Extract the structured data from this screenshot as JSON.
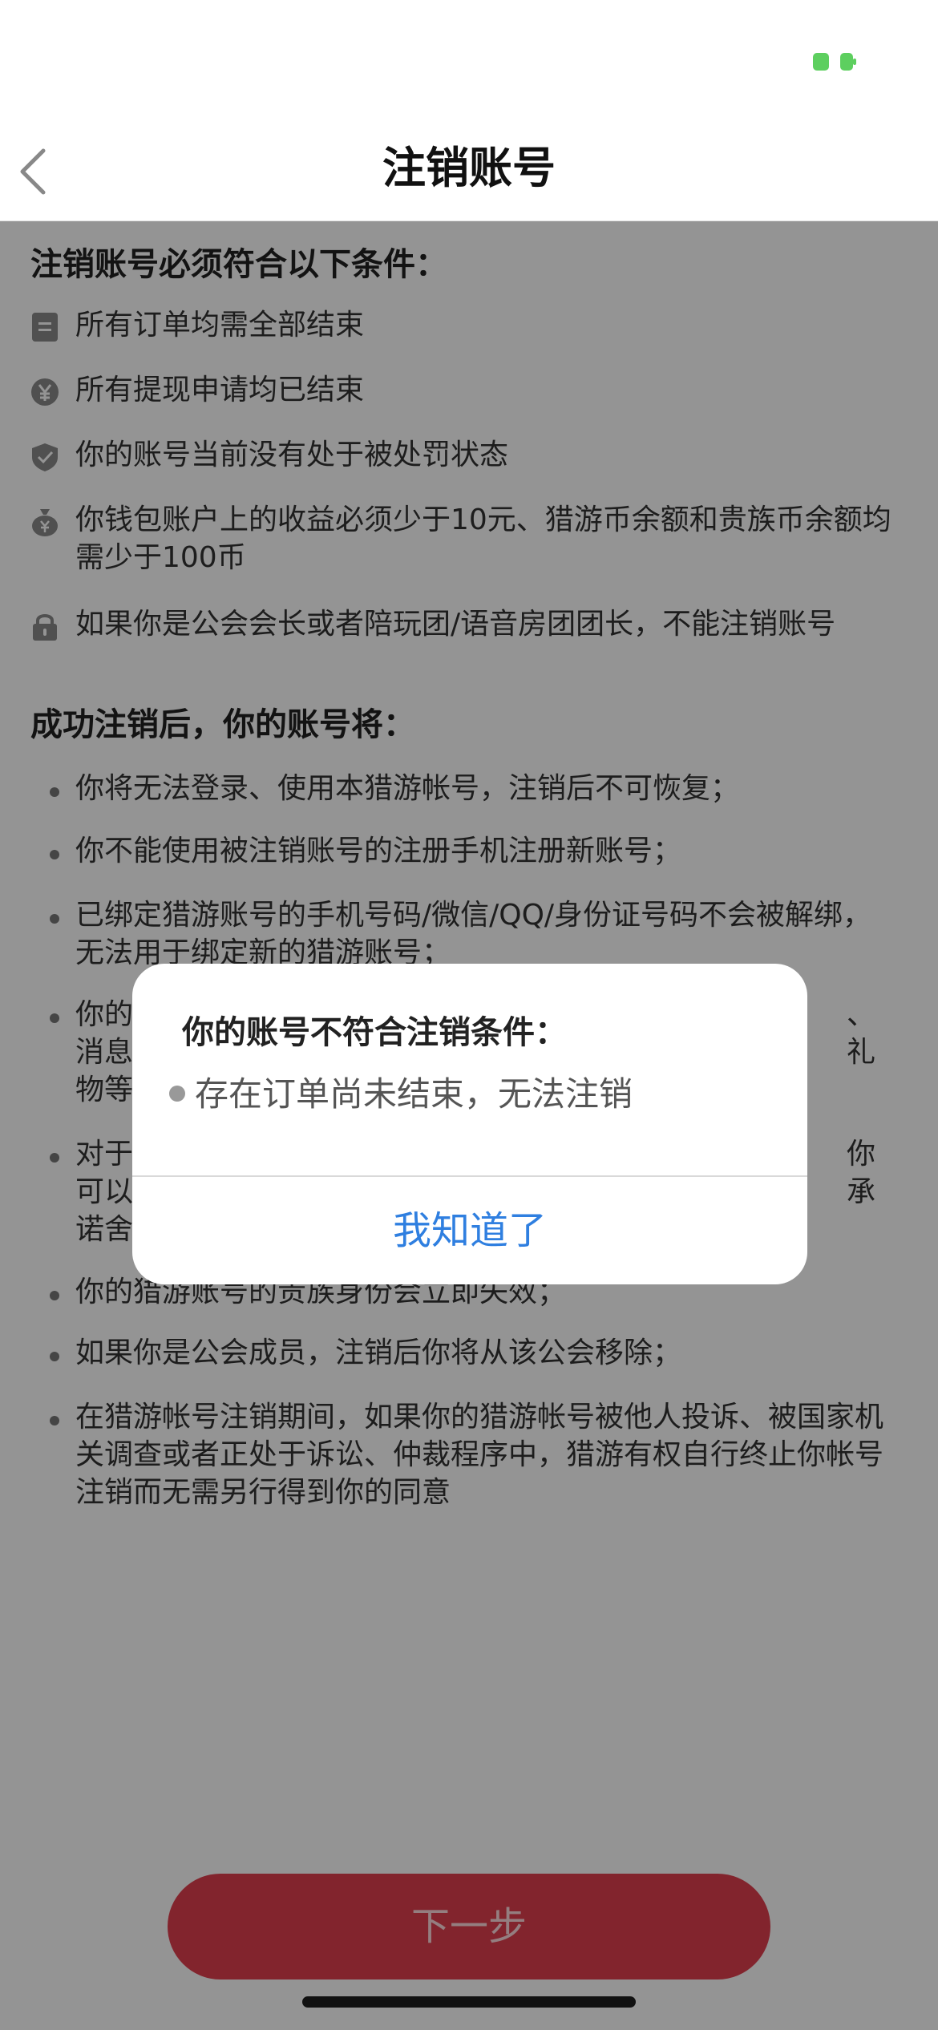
{
  "nav": {
    "title": "注销账号"
  },
  "conditions": {
    "heading": "注销账号必须符合以下条件：",
    "items": [
      {
        "icon": "order-icon",
        "text": "所有订单均需全部结束"
      },
      {
        "icon": "yen-icon",
        "text": "所有提现申请均已结束"
      },
      {
        "icon": "shield-icon",
        "text": "你的账号当前没有处于被处罚状态"
      },
      {
        "icon": "money-bag-icon",
        "text": "你钱包账户上的收益必须少于10元、猎游币余额和贵族币余额均需少于100币"
      },
      {
        "icon": "lock-icon",
        "text": "如果你是公会会长或者陪玩团/语音房团团长，不能注销账号"
      }
    ]
  },
  "after": {
    "heading": "成功注销后，你的账号将：",
    "items": [
      "你将无法登录、使用本猎游帐号，注销后不可恢复；",
      "你不能使用被注销账号的注册手机注册新账号；",
      "已绑定猎游账号的手机号码/微信/QQ/身份证号码不会被解绑，无法用于绑定新的猎游账号；",
      "你的",
      "消息",
      "物等",
      "对于",
      "可以",
      "诺舍",
      "你的猎游账号的贵族身份会立即失效；",
      "如果你是公会成员，注销后你将从该公会移除；",
      "在猎游帐号注销期间，如果你的猎游帐号被他人投诉、被国家机关调查或者正处于诉讼、仲裁程序中，猎游有权自行终止你帐号注销而无需另行得到你的同意"
    ],
    "right_fragments": [
      "、",
      "礼",
      "你",
      "承"
    ]
  },
  "bottom_button": {
    "label": "下一步"
  },
  "dialog": {
    "title": "你的账号不符合注销条件：",
    "message": "存在订单尚未结束，无法注销",
    "confirm_label": "我知道了"
  },
  "colors": {
    "brand_red": "#e03f4f",
    "link_blue": "#2f7fe0",
    "battery_green": "#5dcf5f",
    "overlay": "rgba(0,0,0,0.42)"
  }
}
